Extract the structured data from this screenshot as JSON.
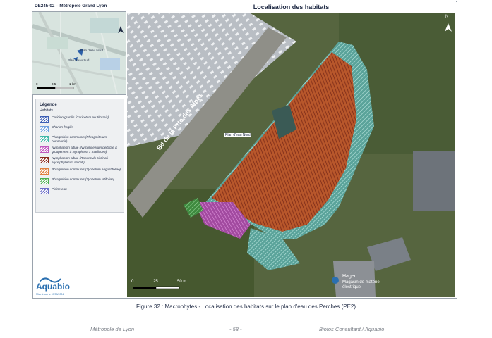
{
  "sidebar": {
    "header": "DE245-02 – Métropole Grand Lyon",
    "inset": {
      "label_nord": "Plan d'eau Nord",
      "label_sud": "Plan d'eau Sud",
      "scale_0": "0",
      "scale_05": "0,5",
      "scale_1": "1 km"
    },
    "legend": {
      "title": "Légende",
      "subtitle": "Habitats",
      "items": [
        {
          "label": "Caricion gracilis (Caricetum acutiformis)",
          "color": "#3d5fb5"
        },
        {
          "label": "Charion fragilis",
          "color": "#6fa0e0"
        },
        {
          "label": "Phragmition communis (Phragmitetum communis)",
          "color": "#3fb8a8"
        },
        {
          "label": "Nymphaeion albae (Nymphaeetum peltatae & groupement à Nymphaea x marliacea)",
          "color": "#c05ac0"
        },
        {
          "label": "Nymphaeion albae (Ranunculo circinati - Myriophylletum spicati)",
          "color": "#8a2a1e"
        },
        {
          "label": "Phragmition communis (Typhetum angustifoliae)",
          "color": "#e08040"
        },
        {
          "label": "Phragmition communis (Typhetum latifoliae)",
          "color": "#4caf50"
        },
        {
          "label": "Pleine eau",
          "color": "#6d6fc9"
        }
      ]
    },
    "logo": {
      "name": "Aquabio",
      "date": "Mise à jour le 09/09/2024"
    }
  },
  "map": {
    "title": "Localisation des habitats",
    "road_label": "Bd de la Prte des Alpes",
    "lake_label": "Plan d'eau Nord",
    "scale_0": "0",
    "scale_25": "25",
    "scale_50": "50 m",
    "poi_hager": "Hager",
    "poi_magasin": "Magasin de matériel électrique",
    "north": "N"
  },
  "caption": "Figure 32 : Macrophytes - Localisation des habitats sur le plan d'eau des Perches (PE2)",
  "footer": {
    "left": "Métropole de Lyon",
    "center": "- 58 -",
    "right": "Biotos Consultant / Aquabio"
  }
}
